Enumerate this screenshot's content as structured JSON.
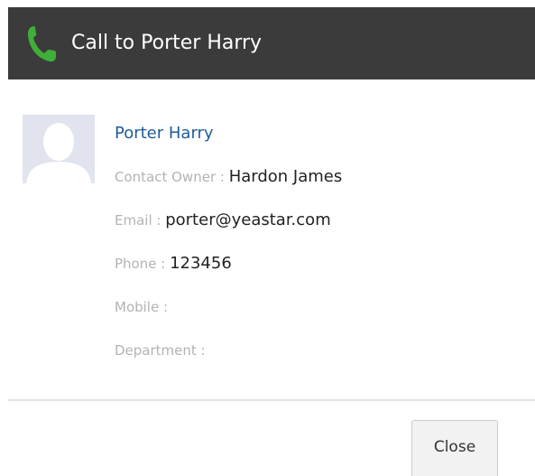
{
  "header": {
    "title": "Call to Porter Harry",
    "icon": "phone-icon",
    "background_color": "#3b3b3b",
    "icon_color": "#3fae3a"
  },
  "contact": {
    "name": "Porter Harry",
    "avatar_icon": "person-silhouette-icon",
    "fields": [
      {
        "label": "Contact Owner : ",
        "value": "Hardon James"
      },
      {
        "label": "Email : ",
        "value": "porter@yeastar.com"
      },
      {
        "label": "Phone : ",
        "value": "123456"
      },
      {
        "label": "Mobile : ",
        "value": ""
      },
      {
        "label": "Department : ",
        "value": ""
      }
    ]
  },
  "footer": {
    "close_label": "Close"
  }
}
